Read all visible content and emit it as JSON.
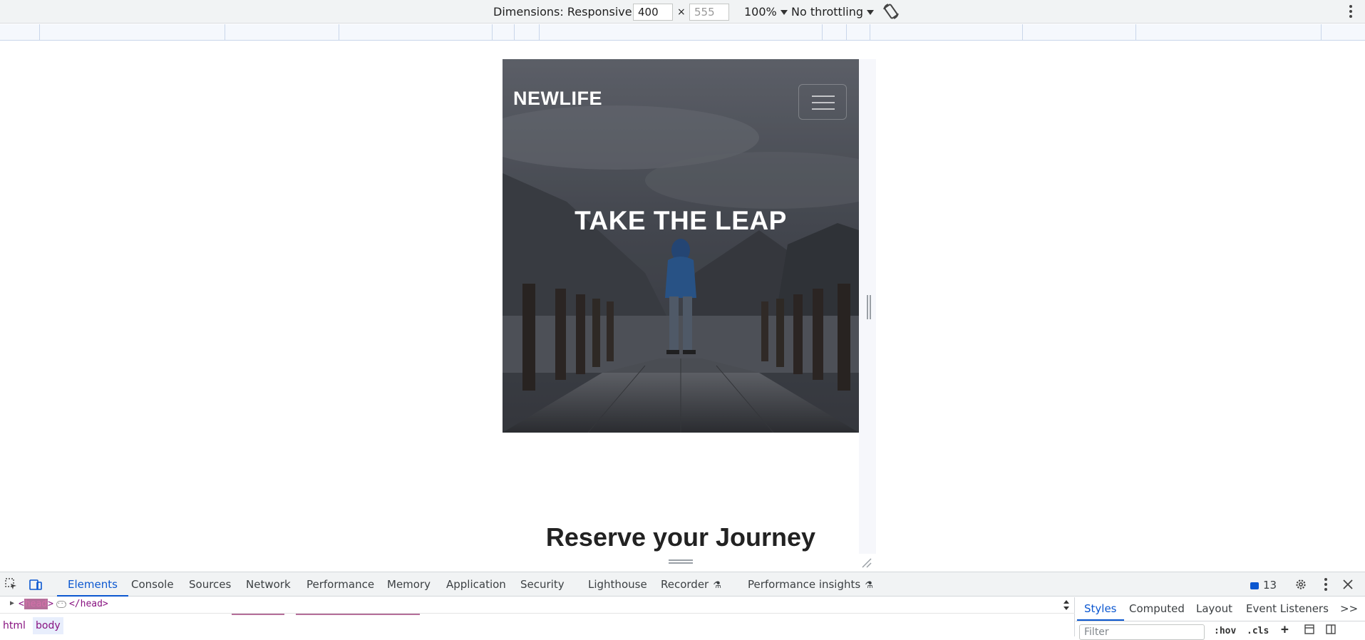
{
  "device_toolbar": {
    "dimensions_label": "Dimensions: Responsive",
    "width_value": "400",
    "height_placeholder": "555",
    "times": "×",
    "zoom": "100%",
    "throttling": "No throttling",
    "rotate_icon": "rotate-icon",
    "more_icon": "kebab-icon"
  },
  "page": {
    "brand": "NEWLIFE",
    "hero_title": "TAKE THE LEAP",
    "section_heading": "Reserve your Journey",
    "hero_colors": {
      "sky": "#5c6069",
      "overlay": "#3a3d44",
      "jacket": "#2b5f9c"
    }
  },
  "devtools": {
    "tabs": [
      "Elements",
      "Console",
      "Sources",
      "Network",
      "Performance",
      "Memory",
      "Application",
      "Security",
      "Lighthouse",
      "Recorder",
      "Performance insights"
    ],
    "active_tab": "Elements",
    "issues_count": "13",
    "dom_line": {
      "open": "<",
      "tag": "head",
      "close": ">",
      "end": "</head>"
    },
    "breadcrumbs": [
      "html",
      "body"
    ],
    "styles_tabs": [
      "Styles",
      "Computed",
      "Layout",
      "Event Listeners"
    ],
    "styles_more": ">>",
    "filter_placeholder": "Filter",
    "hov": ":hov",
    "cls": ".cls",
    "accent": "#0b57d0"
  }
}
